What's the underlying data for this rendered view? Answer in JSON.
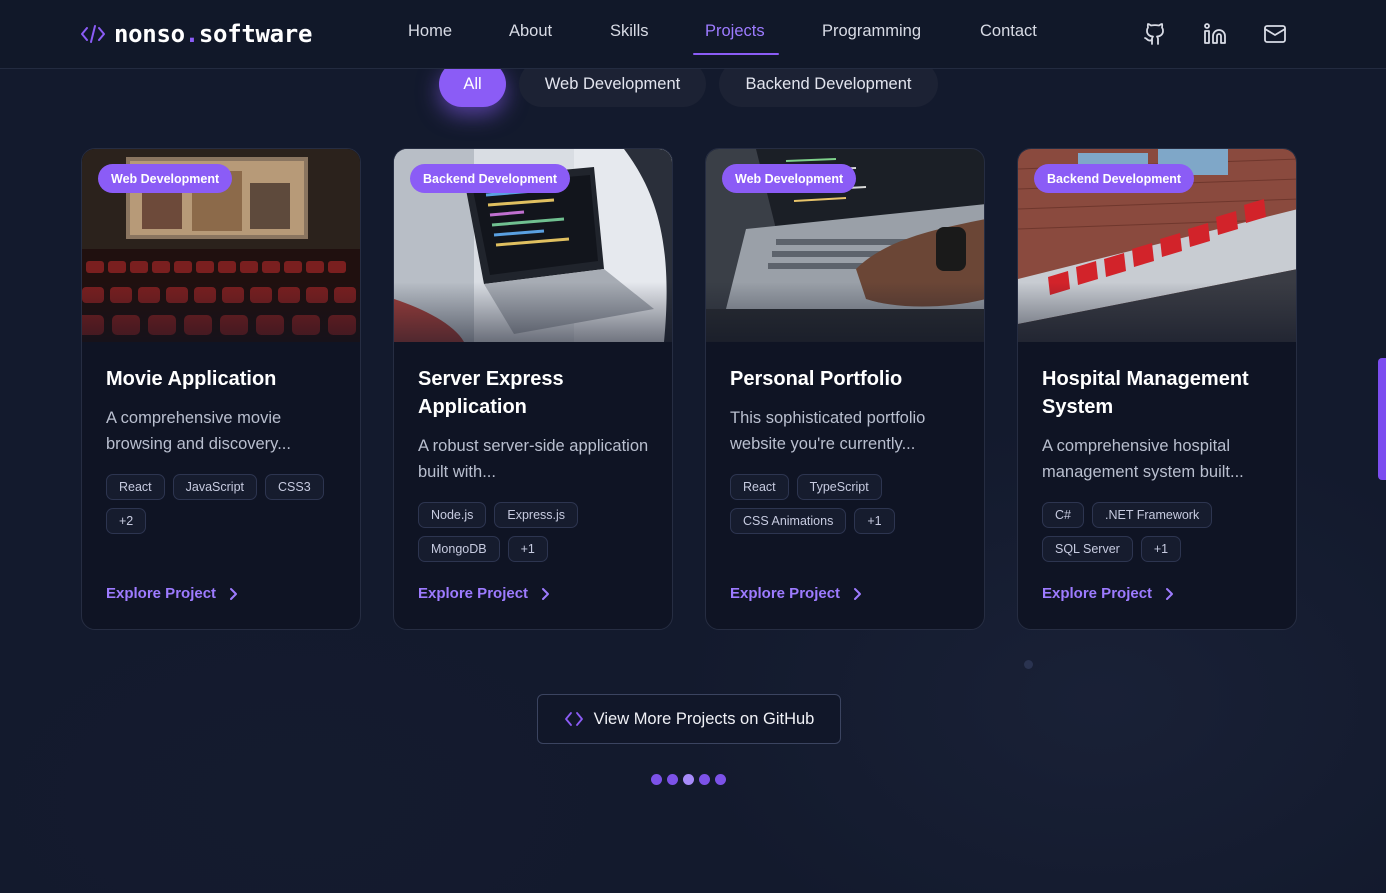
{
  "brand": {
    "prefix": "nonso",
    "dot": ".",
    "suffix": "software",
    "icon": "code-brackets-icon"
  },
  "nav": {
    "items": [
      {
        "label": "Home"
      },
      {
        "label": "About"
      },
      {
        "label": "Skills"
      },
      {
        "label": "Projects",
        "active": true
      },
      {
        "label": "Programming"
      },
      {
        "label": "Contact"
      }
    ],
    "social": [
      "github-icon",
      "linkedin-icon",
      "mail-icon"
    ]
  },
  "filters": [
    {
      "label": "All",
      "active": true
    },
    {
      "label": "Web Development"
    },
    {
      "label": "Backend Development"
    }
  ],
  "projects": [
    {
      "badge": "Web Development",
      "title": "Movie Application",
      "description": "A comprehensive movie browsing and discovery...",
      "tags": [
        "React",
        "JavaScript",
        "CSS3",
        "+2"
      ],
      "cta": "Explore Project"
    },
    {
      "badge": "Backend Development",
      "title": "Server Express Application",
      "description": "A robust server-side application built with...",
      "tags": [
        "Node.js",
        "Express.js",
        "MongoDB",
        "+1"
      ],
      "cta": "Explore Project"
    },
    {
      "badge": "Web Development",
      "title": "Personal Portfolio",
      "description": "This sophisticated portfolio website you're currently...",
      "tags": [
        "React",
        "TypeScript",
        "CSS Animations",
        "+1"
      ],
      "cta": "Explore Project"
    },
    {
      "badge": "Backend Development",
      "title": "Hospital Management System",
      "description": "A comprehensive hospital management system built...",
      "tags": [
        "C#",
        ".NET Framework",
        "SQL Server",
        "+1"
      ],
      "cta": "Explore Project"
    }
  ],
  "github_button": {
    "label": "View More Projects on GitHub",
    "icon": "code-brackets-icon"
  },
  "pagination": {
    "count": 5,
    "active_index": 2
  },
  "colors": {
    "accent": "#8b5cf6",
    "accent_light": "#9d7bff",
    "background": "#131a2d",
    "card": "#0f1424"
  }
}
